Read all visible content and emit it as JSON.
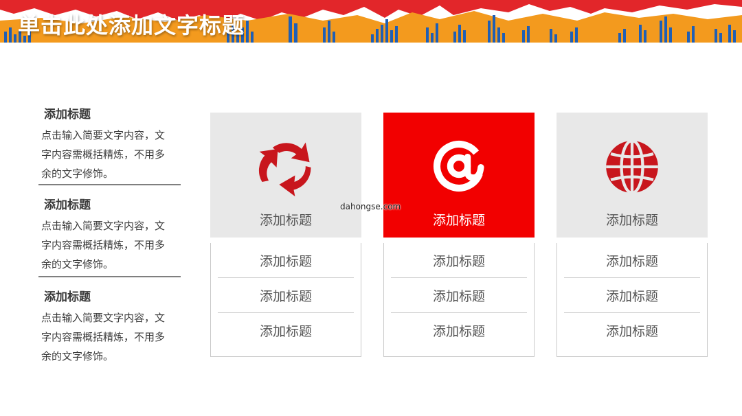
{
  "header": {
    "title": "单击此处添加文字标题"
  },
  "left_items": [
    {
      "title": "添加标题",
      "desc_line1": "点击输入简要文字内容，文",
      "desc_line2": "字内容需概括精炼，不用多",
      "desc_line3": "余的文字修饰。"
    },
    {
      "title": "添加标题",
      "desc_line1": "点击输入简要文字内容，文",
      "desc_line2": "字内容需概括精炼，不用多",
      "desc_line3": "余的文字修饰。"
    },
    {
      "title": "添加标题",
      "desc_line1": "点击输入简要文字内容，文",
      "desc_line2": "字内容需概括精炼，不用多",
      "desc_line3": "余的文字修饰。"
    }
  ],
  "cards": [
    {
      "icon": "recycle-icon",
      "title": "添加标题",
      "rows": [
        "添加标题",
        "添加标题",
        "添加标题"
      ]
    },
    {
      "icon": "at-sign-icon",
      "title": "添加标题",
      "rows": [
        "添加标题",
        "添加标题",
        "添加标题"
      ]
    },
    {
      "icon": "globe-icon",
      "title": "添加标题",
      "rows": [
        "添加标题",
        "添加标题",
        "添加标题"
      ]
    }
  ],
  "watermark": "dahongse.com",
  "colors": {
    "accent_red": "#f20000",
    "icon_red": "#c8161d",
    "banner_orange": "#f39a1e",
    "banner_blue": "#1f5fb5",
    "card_gray": "#e8e8e8"
  }
}
